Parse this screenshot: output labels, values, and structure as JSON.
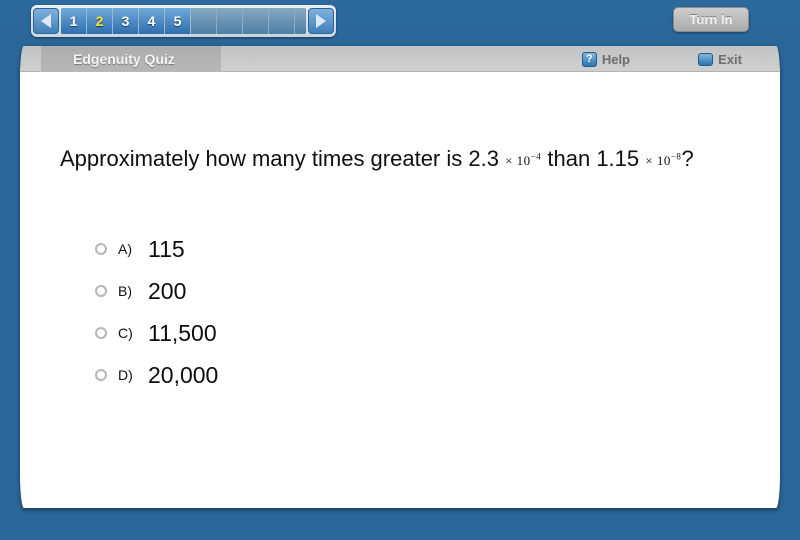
{
  "top_nav": {
    "prev_label": "◀",
    "next_label": "▶",
    "prev_icon": "triangle-left-icon",
    "next_icon": "triangle-right-icon",
    "questions": [
      {
        "label": "1",
        "state": "visited"
      },
      {
        "label": "2",
        "state": "current"
      },
      {
        "label": "3",
        "state": "visited"
      },
      {
        "label": "4",
        "state": "visited"
      },
      {
        "label": "5",
        "state": "visited"
      }
    ],
    "empty_slot_count": 5,
    "turn_in_label": "Turn In",
    "turn_in_state": "disabled"
  },
  "toolbar": {
    "tab_label": "Edgenuity Quiz",
    "help_label": "Help",
    "help_icon_glyph": "?",
    "exit_label": "Exit"
  },
  "question": {
    "part1": "Approximately how many times greater is 2.3",
    "sci1_mult": "× 10",
    "sci1_exp": "−4",
    "part2": "than 1.15",
    "sci2_mult": "× 10",
    "sci2_exp": "−8",
    "part3": "?"
  },
  "options": [
    {
      "letter": "A)",
      "text": "115",
      "selected": false
    },
    {
      "letter": "B)",
      "text": "200",
      "selected": false
    },
    {
      "letter": "C)",
      "text": "11,500",
      "selected": false
    },
    {
      "letter": "D)",
      "text": "20,000",
      "selected": false
    }
  ],
  "colors": {
    "background": "#2a6699",
    "panel": "#ffffff",
    "toolbar": "#c7c7c7",
    "current_question": "#ffe033",
    "accent_blue": "#2e74b0"
  }
}
